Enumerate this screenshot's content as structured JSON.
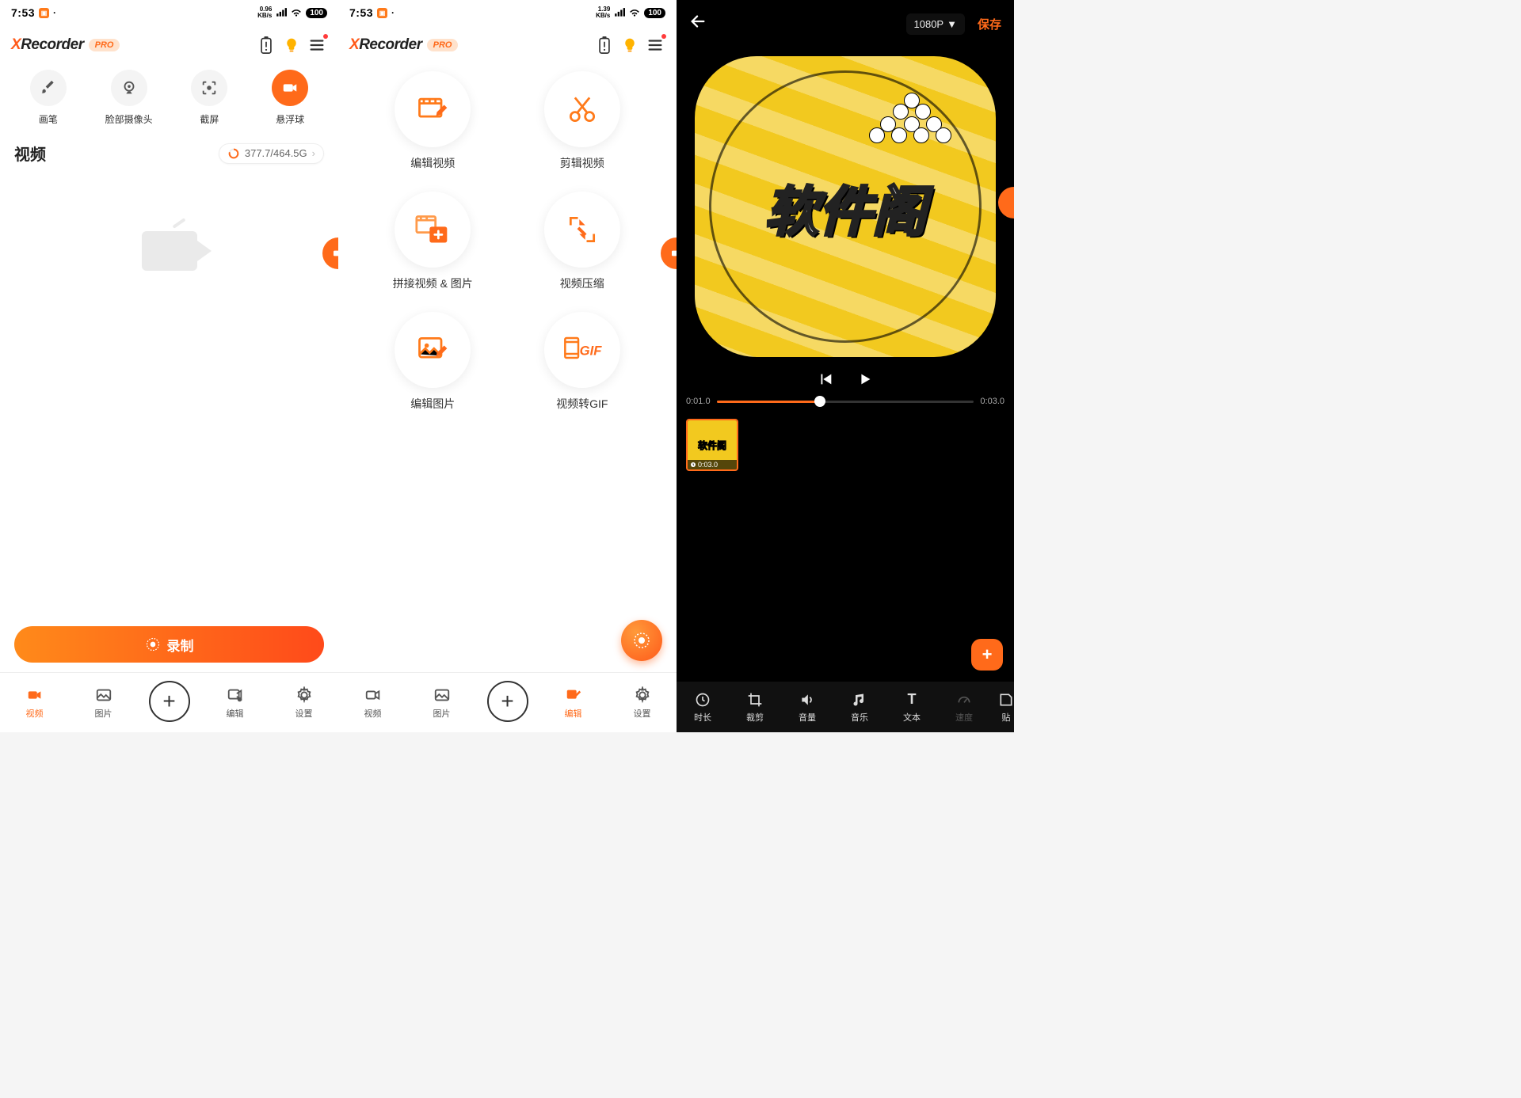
{
  "status": {
    "time1": "7:53",
    "time2": "7:53",
    "kbs1": "0.96\nKB/s",
    "kbs2": "1.39\nKB/s",
    "battery": "100"
  },
  "appbar": {
    "logo_x": "X",
    "logo_rest": "Recorder",
    "pro": "PRO"
  },
  "s1": {
    "tools": {
      "brush": "画笔",
      "face": "脸部摄像头",
      "shot": "截屏",
      "float": "悬浮球"
    },
    "section_title": "视频",
    "storage": "377.7/464.5G",
    "record": "录制"
  },
  "bnav": {
    "video": "视频",
    "photo": "图片",
    "edit": "编辑",
    "settings": "设置"
  },
  "s2": {
    "edit_video": "编辑视频",
    "trim_video": "剪辑视频",
    "merge": "拼接视频 & 图片",
    "compress": "视频压缩",
    "edit_photo": "编辑图片",
    "to_gif": "视频转GIF"
  },
  "s3": {
    "resolution": "1080P",
    "save": "保存",
    "badge_text": "软件阁",
    "time_cur": "0:01.0",
    "time_total": "0:03.0",
    "clip_dur": "0:03.0",
    "tools": {
      "duration": "时长",
      "crop": "裁剪",
      "volume": "音量",
      "music": "音乐",
      "text": "文本",
      "speed": "速度",
      "sticker": "贴"
    }
  }
}
